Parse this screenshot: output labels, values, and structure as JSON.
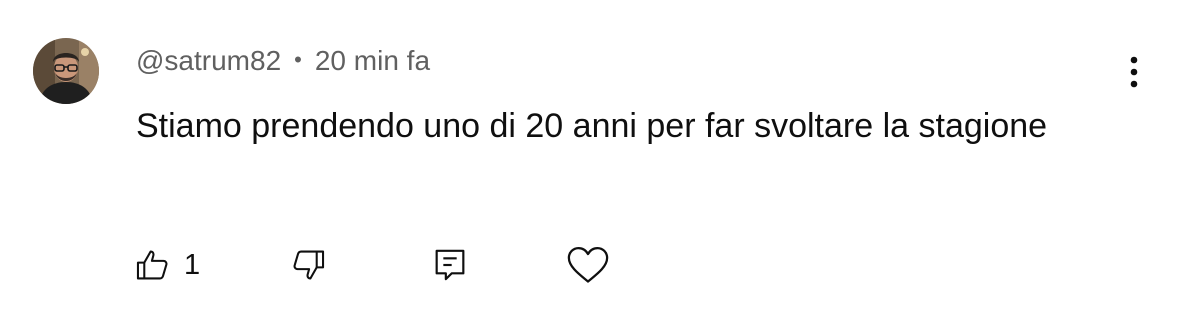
{
  "comment": {
    "username": "@satrum82",
    "separator": "•",
    "timestamp": "20 min fa",
    "text": "Stiamo prendendo uno di 20 anni per far svoltare la stagione",
    "like_count": "1"
  },
  "icons": {
    "avatar": "user-avatar-photo",
    "more": "vertical-ellipsis-icon",
    "like": "thumbs-up-icon",
    "dislike": "thumbs-down-icon",
    "reply": "comment-reply-icon",
    "heart": "heart-icon"
  },
  "colors": {
    "text_primary": "#0f0f0f",
    "text_secondary": "#606060",
    "background": "#ffffff"
  }
}
